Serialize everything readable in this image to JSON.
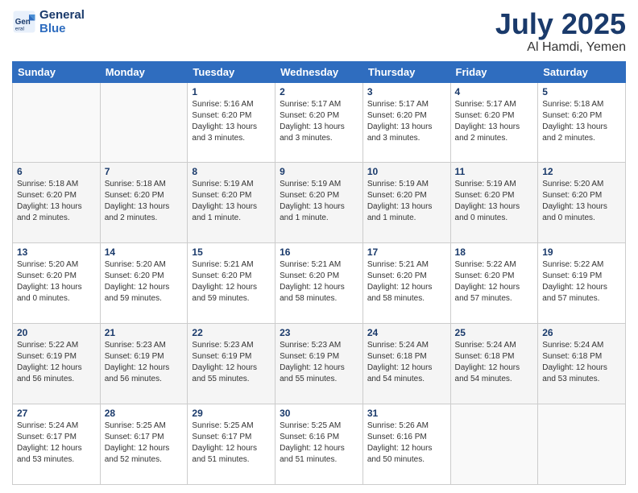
{
  "app": {
    "logo_line1": "General",
    "logo_line2": "Blue"
  },
  "title": {
    "month": "July 2025",
    "location": "Al Hamdi, Yemen"
  },
  "weekdays": [
    "Sunday",
    "Monday",
    "Tuesday",
    "Wednesday",
    "Thursday",
    "Friday",
    "Saturday"
  ],
  "days": [
    {
      "num": "",
      "sunrise": "",
      "sunset": "",
      "daylight": ""
    },
    {
      "num": "",
      "sunrise": "",
      "sunset": "",
      "daylight": ""
    },
    {
      "num": "1",
      "sunrise": "Sunrise: 5:16 AM",
      "sunset": "Sunset: 6:20 PM",
      "daylight": "Daylight: 13 hours and 3 minutes."
    },
    {
      "num": "2",
      "sunrise": "Sunrise: 5:17 AM",
      "sunset": "Sunset: 6:20 PM",
      "daylight": "Daylight: 13 hours and 3 minutes."
    },
    {
      "num": "3",
      "sunrise": "Sunrise: 5:17 AM",
      "sunset": "Sunset: 6:20 PM",
      "daylight": "Daylight: 13 hours and 3 minutes."
    },
    {
      "num": "4",
      "sunrise": "Sunrise: 5:17 AM",
      "sunset": "Sunset: 6:20 PM",
      "daylight": "Daylight: 13 hours and 2 minutes."
    },
    {
      "num": "5",
      "sunrise": "Sunrise: 5:18 AM",
      "sunset": "Sunset: 6:20 PM",
      "daylight": "Daylight: 13 hours and 2 minutes."
    },
    {
      "num": "6",
      "sunrise": "Sunrise: 5:18 AM",
      "sunset": "Sunset: 6:20 PM",
      "daylight": "Daylight: 13 hours and 2 minutes."
    },
    {
      "num": "7",
      "sunrise": "Sunrise: 5:18 AM",
      "sunset": "Sunset: 6:20 PM",
      "daylight": "Daylight: 13 hours and 2 minutes."
    },
    {
      "num": "8",
      "sunrise": "Sunrise: 5:19 AM",
      "sunset": "Sunset: 6:20 PM",
      "daylight": "Daylight: 13 hours and 1 minute."
    },
    {
      "num": "9",
      "sunrise": "Sunrise: 5:19 AM",
      "sunset": "Sunset: 6:20 PM",
      "daylight": "Daylight: 13 hours and 1 minute."
    },
    {
      "num": "10",
      "sunrise": "Sunrise: 5:19 AM",
      "sunset": "Sunset: 6:20 PM",
      "daylight": "Daylight: 13 hours and 1 minute."
    },
    {
      "num": "11",
      "sunrise": "Sunrise: 5:19 AM",
      "sunset": "Sunset: 6:20 PM",
      "daylight": "Daylight: 13 hours and 0 minutes."
    },
    {
      "num": "12",
      "sunrise": "Sunrise: 5:20 AM",
      "sunset": "Sunset: 6:20 PM",
      "daylight": "Daylight: 13 hours and 0 minutes."
    },
    {
      "num": "13",
      "sunrise": "Sunrise: 5:20 AM",
      "sunset": "Sunset: 6:20 PM",
      "daylight": "Daylight: 13 hours and 0 minutes."
    },
    {
      "num": "14",
      "sunrise": "Sunrise: 5:20 AM",
      "sunset": "Sunset: 6:20 PM",
      "daylight": "Daylight: 12 hours and 59 minutes."
    },
    {
      "num": "15",
      "sunrise": "Sunrise: 5:21 AM",
      "sunset": "Sunset: 6:20 PM",
      "daylight": "Daylight: 12 hours and 59 minutes."
    },
    {
      "num": "16",
      "sunrise": "Sunrise: 5:21 AM",
      "sunset": "Sunset: 6:20 PM",
      "daylight": "Daylight: 12 hours and 58 minutes."
    },
    {
      "num": "17",
      "sunrise": "Sunrise: 5:21 AM",
      "sunset": "Sunset: 6:20 PM",
      "daylight": "Daylight: 12 hours and 58 minutes."
    },
    {
      "num": "18",
      "sunrise": "Sunrise: 5:22 AM",
      "sunset": "Sunset: 6:20 PM",
      "daylight": "Daylight: 12 hours and 57 minutes."
    },
    {
      "num": "19",
      "sunrise": "Sunrise: 5:22 AM",
      "sunset": "Sunset: 6:19 PM",
      "daylight": "Daylight: 12 hours and 57 minutes."
    },
    {
      "num": "20",
      "sunrise": "Sunrise: 5:22 AM",
      "sunset": "Sunset: 6:19 PM",
      "daylight": "Daylight: 12 hours and 56 minutes."
    },
    {
      "num": "21",
      "sunrise": "Sunrise: 5:23 AM",
      "sunset": "Sunset: 6:19 PM",
      "daylight": "Daylight: 12 hours and 56 minutes."
    },
    {
      "num": "22",
      "sunrise": "Sunrise: 5:23 AM",
      "sunset": "Sunset: 6:19 PM",
      "daylight": "Daylight: 12 hours and 55 minutes."
    },
    {
      "num": "23",
      "sunrise": "Sunrise: 5:23 AM",
      "sunset": "Sunset: 6:19 PM",
      "daylight": "Daylight: 12 hours and 55 minutes."
    },
    {
      "num": "24",
      "sunrise": "Sunrise: 5:24 AM",
      "sunset": "Sunset: 6:18 PM",
      "daylight": "Daylight: 12 hours and 54 minutes."
    },
    {
      "num": "25",
      "sunrise": "Sunrise: 5:24 AM",
      "sunset": "Sunset: 6:18 PM",
      "daylight": "Daylight: 12 hours and 54 minutes."
    },
    {
      "num": "26",
      "sunrise": "Sunrise: 5:24 AM",
      "sunset": "Sunset: 6:18 PM",
      "daylight": "Daylight: 12 hours and 53 minutes."
    },
    {
      "num": "27",
      "sunrise": "Sunrise: 5:24 AM",
      "sunset": "Sunset: 6:17 PM",
      "daylight": "Daylight: 12 hours and 53 minutes."
    },
    {
      "num": "28",
      "sunrise": "Sunrise: 5:25 AM",
      "sunset": "Sunset: 6:17 PM",
      "daylight": "Daylight: 12 hours and 52 minutes."
    },
    {
      "num": "29",
      "sunrise": "Sunrise: 5:25 AM",
      "sunset": "Sunset: 6:17 PM",
      "daylight": "Daylight: 12 hours and 51 minutes."
    },
    {
      "num": "30",
      "sunrise": "Sunrise: 5:25 AM",
      "sunset": "Sunset: 6:16 PM",
      "daylight": "Daylight: 12 hours and 51 minutes."
    },
    {
      "num": "31",
      "sunrise": "Sunrise: 5:26 AM",
      "sunset": "Sunset: 6:16 PM",
      "daylight": "Daylight: 12 hours and 50 minutes."
    },
    {
      "num": "",
      "sunrise": "",
      "sunset": "",
      "daylight": ""
    },
    {
      "num": "",
      "sunrise": "",
      "sunset": "",
      "daylight": ""
    }
  ]
}
